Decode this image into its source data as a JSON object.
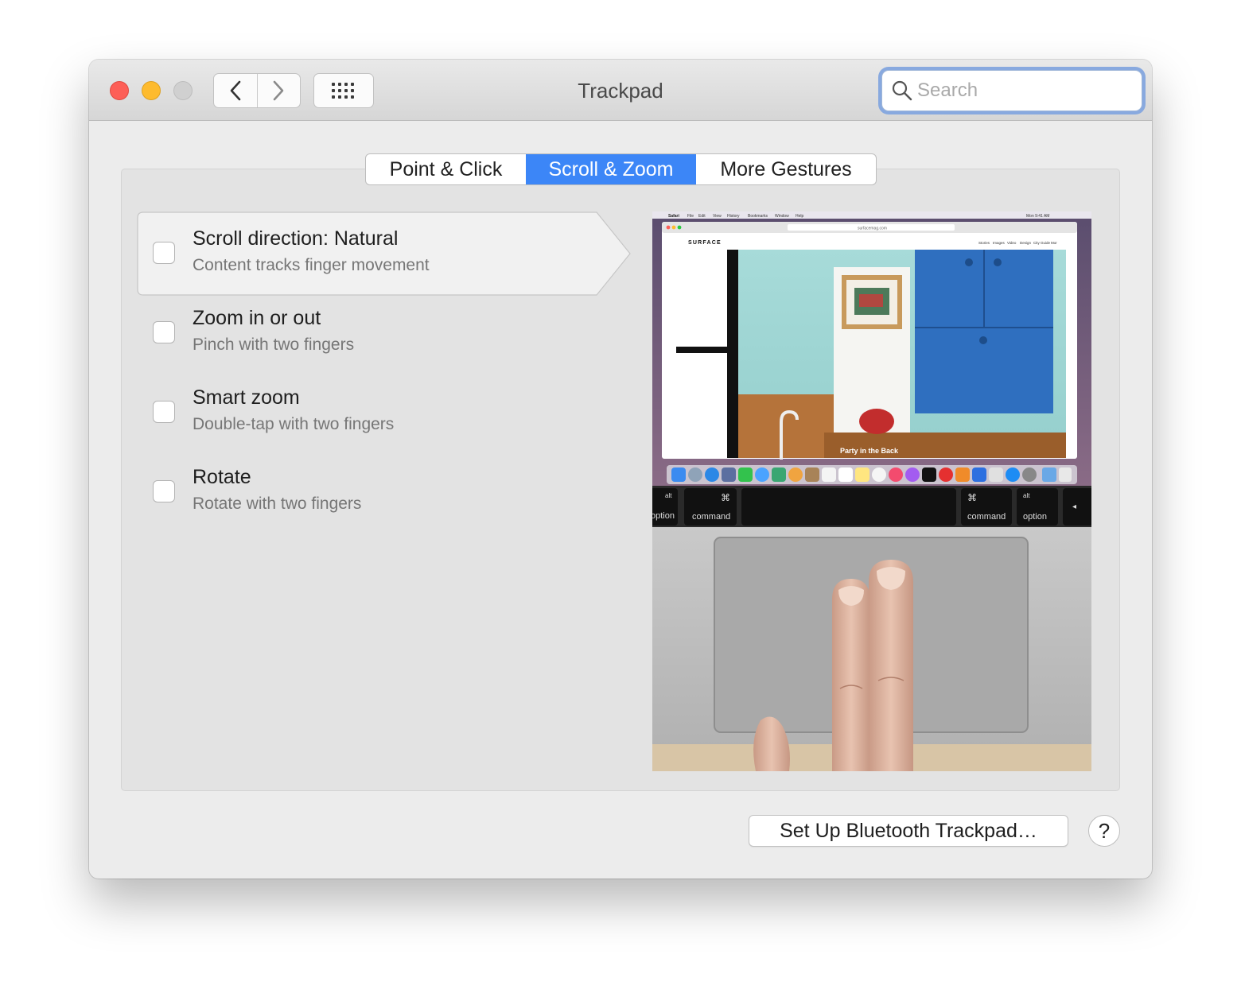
{
  "window": {
    "title": "Trackpad",
    "search_placeholder": "Search"
  },
  "tabs": [
    {
      "label": "Point & Click",
      "selected": false
    },
    {
      "label": "Scroll & Zoom",
      "selected": true
    },
    {
      "label": "More Gestures",
      "selected": false
    }
  ],
  "options": [
    {
      "title": "Scroll direction: Natural",
      "subtitle": "Content tracks finger movement",
      "checked": false,
      "selected": true
    },
    {
      "title": "Zoom in or out",
      "subtitle": "Pinch with two fingers",
      "checked": false,
      "selected": false
    },
    {
      "title": "Smart zoom",
      "subtitle": "Double-tap with two fingers",
      "checked": false,
      "selected": false
    },
    {
      "title": "Rotate",
      "subtitle": "Rotate with two fingers",
      "checked": false,
      "selected": false
    }
  ],
  "preview": {
    "menu_app": "Safari",
    "menu_items": [
      "File",
      "Edit",
      "View",
      "History",
      "Bookmarks",
      "Window",
      "Help"
    ],
    "menu_clock": "Mon 9:41 AM",
    "url": "surfacemag.com",
    "site_name": "SURFACE",
    "site_nav": [
      "Stories",
      "Images",
      "Video",
      "Design",
      "City Guide",
      "Mor"
    ],
    "caption": "Party in the Back",
    "keys": {
      "left_option_top": "alt",
      "left_option": "option",
      "left_command_symbol": "⌘",
      "left_command": "command",
      "right_command_symbol": "⌘",
      "right_command": "command",
      "right_option_top": "alt",
      "right_option": "option",
      "arrow": "◂"
    }
  },
  "footer": {
    "setup_button": "Set Up Bluetooth Trackpad…",
    "help_button": "?"
  }
}
